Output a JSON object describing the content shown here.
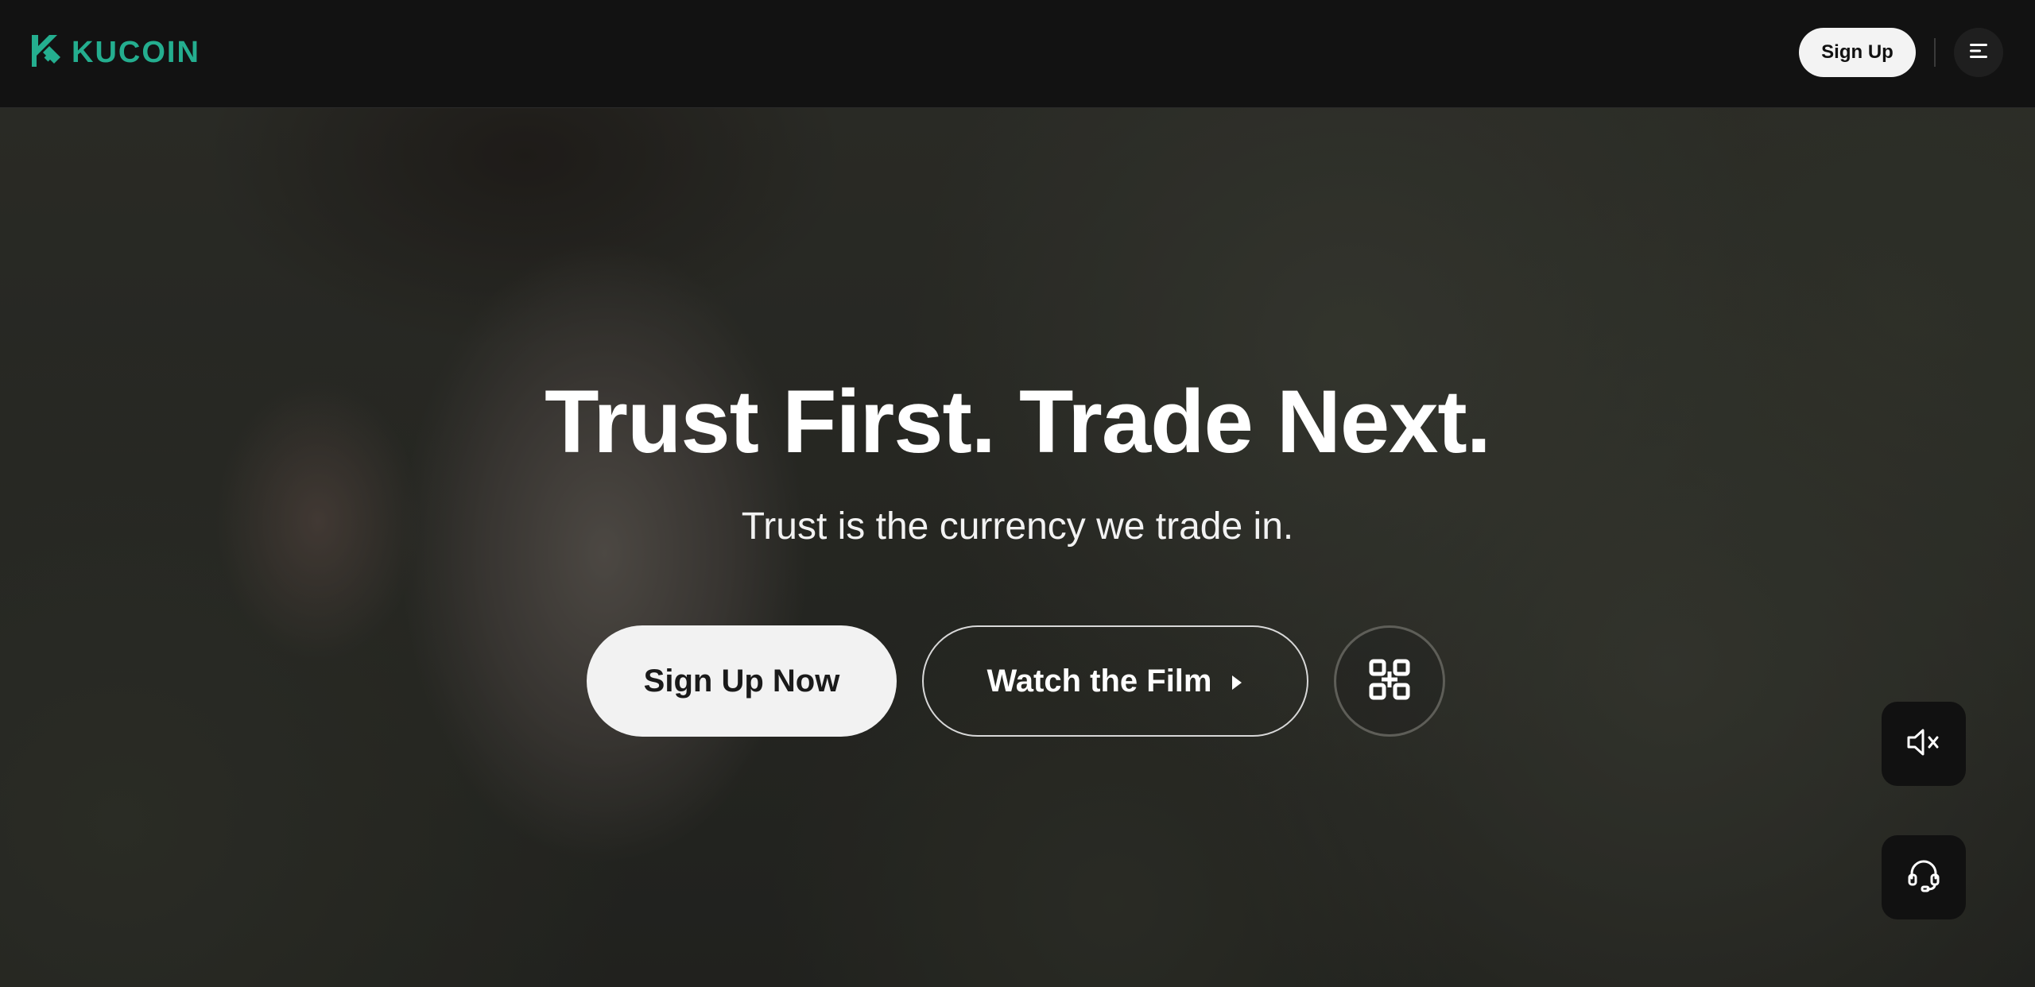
{
  "header": {
    "logo_text": "KUCOIN",
    "logo_icon": "kucoin-logo-icon",
    "signup_label": "Sign Up",
    "menu_icon": "menu-icon"
  },
  "hero": {
    "headline": "Trust First. Trade Next.",
    "subheadline": "Trust is the currency we trade in.",
    "primary_button": "Sign Up Now",
    "secondary_button": "Watch the Film",
    "secondary_icon": "play-icon",
    "qr_icon": "qr-code-icon"
  },
  "floating": {
    "mute_icon": "mute-icon",
    "support_icon": "headset-icon"
  },
  "colors": {
    "brand": "#24ae8f",
    "header_bg": "#121212",
    "button_light": "#f2f2f2"
  }
}
